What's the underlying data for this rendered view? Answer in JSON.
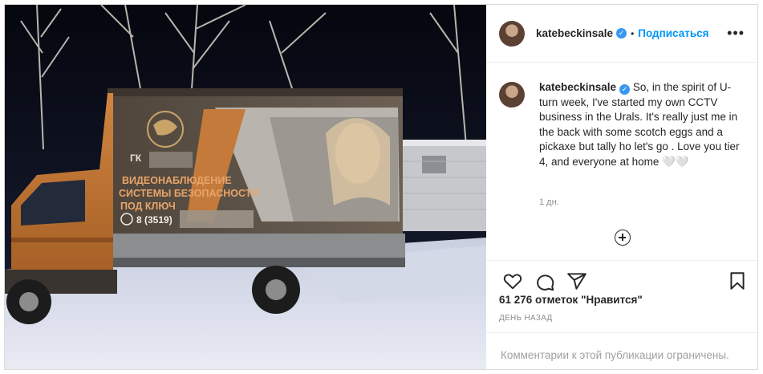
{
  "photo": {
    "description_label": "",
    "truck_text": {
      "company": "ГК",
      "line1": "ВИДЕОНАБЛЮДЕНИЕ",
      "line2": "СИСТЕМЫ БЕЗОПАСНОСТИ",
      "line3": "ПОД КЛЮЧ",
      "phone": "8 (3519)"
    }
  },
  "header": {
    "username": "katebeckinsale",
    "dot": "•",
    "follow_label": "Подписаться",
    "more_label": "•••"
  },
  "caption": {
    "username": "katebeckinsale",
    "text": "So, in the spirit of U-turn week, I've started my own CCTV business in the Urals. It's really just me in the back with some scotch eggs and a pickaxe but tally ho let's go . Love you tier 4, and everyone at home 🤍🤍"
  },
  "time_ago": "1 дн.",
  "likes": "61 276 отметок \"Нравится\"",
  "date": "ДЕНЬ НАЗАД",
  "comments_notice": "Комментарии к этой публикации ограничены.",
  "icons": {
    "like": "heart-icon",
    "comment": "comment-icon",
    "share": "share-icon",
    "save": "bookmark-icon",
    "add": "plus-circle-icon",
    "verified": "verified-badge-icon"
  },
  "colors": {
    "accent": "#0095f6",
    "verified": "#3897f0",
    "truck": "#c87a3a",
    "canopy": "#5c5044"
  }
}
